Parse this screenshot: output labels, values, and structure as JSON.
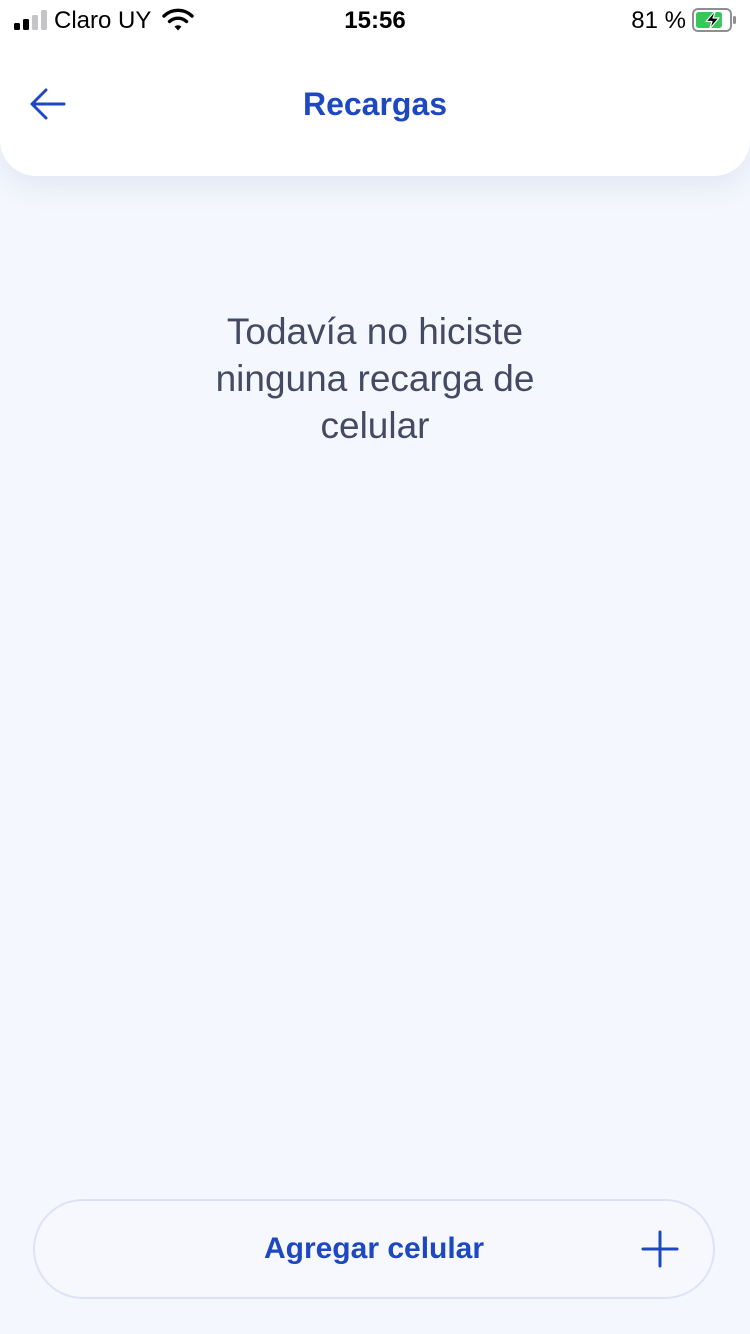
{
  "status_bar": {
    "carrier": "Claro UY",
    "time": "15:56",
    "battery_percent": "81 %",
    "battery_level": 0.81,
    "charging": true,
    "signal_bars": 2
  },
  "header": {
    "back_icon": "arrow-left-icon",
    "title": "Recargas"
  },
  "empty_state": {
    "message": "Todavía no hiciste ninguna recarga de celular"
  },
  "add_button": {
    "label": "Agregar celular",
    "icon": "plus-icon"
  },
  "colors": {
    "accent": "#1e48c2",
    "background": "#f4f7fd",
    "text_secondary": "#454a63",
    "battery_fill": "#34c759"
  }
}
